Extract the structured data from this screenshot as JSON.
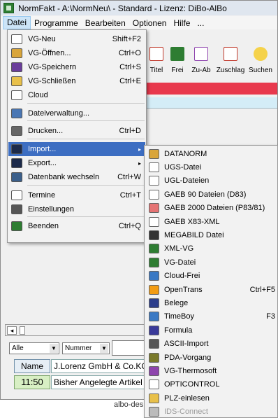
{
  "window": {
    "title": "NormFakt  - A:\\NormNeu\\ - Standard - Lizenz: DiBo-AlBo"
  },
  "menubar": [
    {
      "label": "Datei"
    },
    {
      "label": "Programme"
    },
    {
      "label": "Bearbeiten"
    },
    {
      "label": "Optionen"
    },
    {
      "label": "Hilfe"
    },
    {
      "label": "..."
    }
  ],
  "toolbar": [
    {
      "label": "Titel",
      "icon": "calendar-icon",
      "color": "#c0392b"
    },
    {
      "label": "Frei",
      "icon": "edit-icon",
      "color": "#2e7d32"
    },
    {
      "label": "Zu-Ab",
      "icon": "plusminus-icon",
      "color": "#8e44ad"
    },
    {
      "label": "Zuschlag",
      "icon": "percent-icon",
      "color": "#c0392b"
    },
    {
      "label": "Suchen",
      "icon": "search-icon",
      "color": "#d4a017"
    }
  ],
  "datei_menu": [
    {
      "label": "VG-Neu",
      "shortcut": "Shift+F2",
      "icon": "new-doc-icon",
      "color": "#ffffff"
    },
    {
      "label": "VG-Öffnen...",
      "shortcut": "Ctrl+O",
      "icon": "open-folder-icon",
      "color": "#d9a53a"
    },
    {
      "label": "VG-Speichern",
      "shortcut": "Ctrl+S",
      "icon": "save-icon",
      "color": "#6a3d9a"
    },
    {
      "label": "VG-Schließen",
      "shortcut": "Ctrl+E",
      "icon": "folder-icon",
      "color": "#e8c04a"
    },
    {
      "label": "Cloud",
      "shortcut": "",
      "icon": "cloud-icon",
      "color": "#ffffff"
    },
    {
      "label": "Dateiverwaltung...",
      "shortcut": "",
      "icon": "table-icon",
      "color": "#4a77b4"
    },
    {
      "label": "Drucken...",
      "shortcut": "Ctrl+D",
      "icon": "printer-icon",
      "color": "#666666"
    },
    {
      "label": "Import...",
      "shortcut": "",
      "icon": "import-icon",
      "color": "#1c2a4a"
    },
    {
      "label": "Export...",
      "shortcut": "",
      "icon": "export-icon",
      "color": "#1c2a4a"
    },
    {
      "label": "Datenbank wechseln",
      "shortcut": "Ctrl+W",
      "icon": "database-switch-icon",
      "color": "#3b5f8a"
    },
    {
      "label": "Termine",
      "shortcut": "Ctrl+T",
      "icon": "clock-icon",
      "color": "#ffffff"
    },
    {
      "label": "Einstellungen",
      "shortcut": "",
      "icon": "settings-icon",
      "color": "#555555"
    },
    {
      "label": "Beenden",
      "shortcut": "Ctrl+Q",
      "icon": "exit-icon",
      "color": "#2e7d32"
    }
  ],
  "import_menu": [
    {
      "label": "DATANORM",
      "shortcut": "",
      "icon": "datanorm-icon",
      "color": "#d9a53a"
    },
    {
      "label": "UGS-Datei",
      "shortcut": "",
      "icon": "ugs-icon",
      "color": "#ffffff"
    },
    {
      "label": "UGL-Dateien",
      "shortcut": "",
      "icon": "ugl-icon",
      "color": "#ffffff"
    },
    {
      "label": "GAEB 90 Dateien (D83)",
      "shortcut": "",
      "icon": "gaeb90-icon",
      "color": "#ffffff"
    },
    {
      "label": "GAEB 2000 Dateien (P83/81)",
      "shortcut": "",
      "icon": "gaeb2000-icon",
      "color": "#e57373"
    },
    {
      "label": "GAEB X83-XML",
      "shortcut": "",
      "icon": "xml-icon",
      "color": "#ffffff"
    },
    {
      "label": "MEGABILD Datei",
      "shortcut": "",
      "icon": "camera-icon",
      "color": "#333333"
    },
    {
      "label": "XML-VG",
      "shortcut": "",
      "icon": "xml-vg-icon",
      "color": "#2e7d32"
    },
    {
      "label": "VG-Datei",
      "shortcut": "",
      "icon": "vg-file-icon",
      "color": "#2e7d32"
    },
    {
      "label": "Cloud-Frei",
      "shortcut": "",
      "icon": "cloud-icon",
      "color": "#3a79c4"
    },
    {
      "label": "OpenTrans",
      "shortcut": "Ctrl+F5",
      "icon": "opentrans-icon",
      "color": "#f39c12"
    },
    {
      "label": "Belege",
      "shortcut": "",
      "icon": "belege-icon",
      "color": "#2c3e8c"
    },
    {
      "label": "TimeBoy",
      "shortcut": "F3",
      "icon": "timeboy-icon",
      "color": "#3a79c4"
    },
    {
      "label": "Formula",
      "shortcut": "",
      "icon": "formula-icon",
      "color": "#3a3a9a"
    },
    {
      "label": "ASCII-Import",
      "shortcut": "",
      "icon": "ascii-icon",
      "color": "#555555"
    },
    {
      "label": "PDA-Vorgang",
      "shortcut": "",
      "icon": "pda-icon",
      "color": "#7a7a2a"
    },
    {
      "label": "VG-Thermosoft",
      "shortcut": "",
      "icon": "thermosoft-icon",
      "color": "#8e44ad"
    },
    {
      "label": "OPTICONTROL",
      "shortcut": "",
      "icon": "clock-icon",
      "color": "#ffffff"
    },
    {
      "label": "PLZ-einlesen",
      "shortcut": "",
      "icon": "plz-icon",
      "color": "#e8c04a"
    },
    {
      "label": "IDS-Connect",
      "shortcut": "",
      "icon": "ids-icon",
      "color": "#bbbbbb",
      "disabled": true
    }
  ],
  "bottom": {
    "filter1": "Alle",
    "filter2": "Nummer",
    "name_button": "Name",
    "name_value": "J.Lorenz GmbH & Co.KG",
    "time": "11:50",
    "info": "Bisher Angelegte Artikel",
    "footer": "albo-des"
  }
}
